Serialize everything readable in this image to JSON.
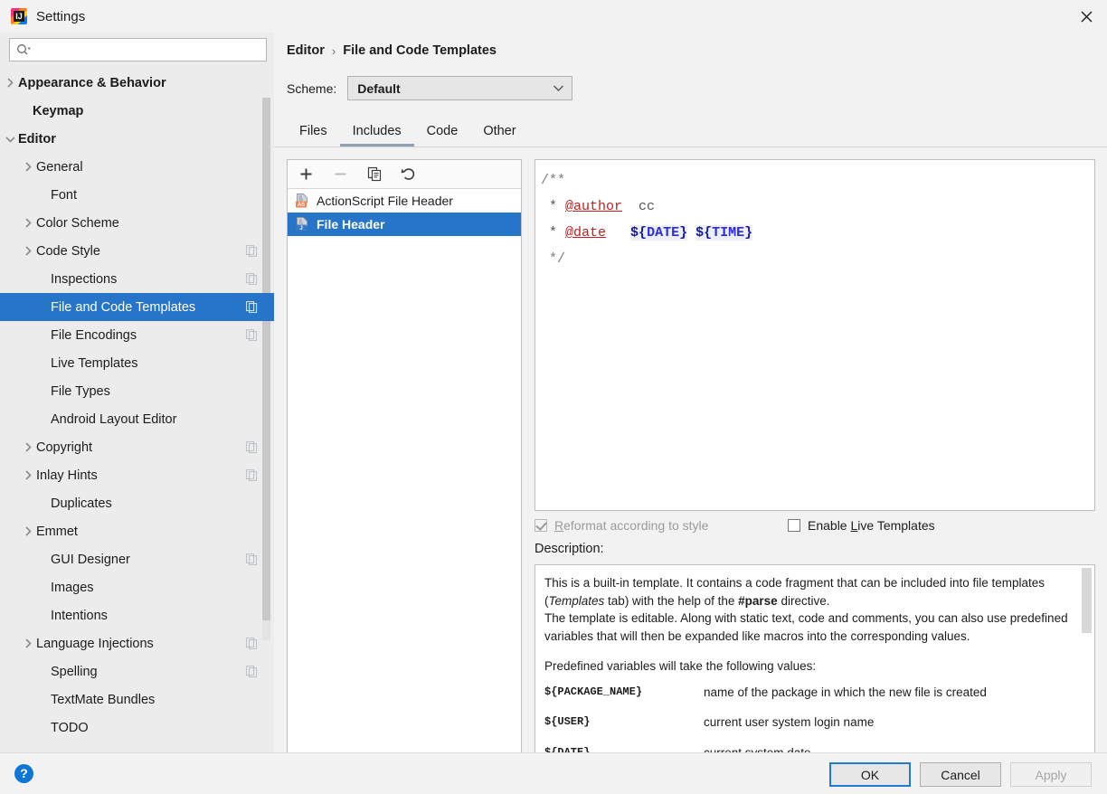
{
  "window": {
    "title": "Settings",
    "app_icon": "intellij-idea-icon",
    "close_icon": "close-icon"
  },
  "search": {
    "value": "",
    "placeholder": "",
    "icon": "search-icon"
  },
  "sidebar": {
    "items": [
      {
        "label": "Appearance & Behavior",
        "indent": 20,
        "arrow": "collapsed",
        "bold": true,
        "badge": false,
        "selected": false
      },
      {
        "label": "Keymap",
        "indent": 36,
        "arrow": "none",
        "bold": true,
        "badge": false,
        "selected": false
      },
      {
        "label": "Editor",
        "indent": 20,
        "arrow": "expanded",
        "bold": true,
        "badge": false,
        "selected": false
      },
      {
        "label": "General",
        "indent": 40,
        "arrow": "collapsed",
        "bold": false,
        "badge": false,
        "selected": false
      },
      {
        "label": "Font",
        "indent": 56,
        "arrow": "none",
        "bold": false,
        "badge": false,
        "selected": false
      },
      {
        "label": "Color Scheme",
        "indent": 40,
        "arrow": "collapsed",
        "bold": false,
        "badge": false,
        "selected": false
      },
      {
        "label": "Code Style",
        "indent": 40,
        "arrow": "collapsed",
        "bold": false,
        "badge": true,
        "selected": false
      },
      {
        "label": "Inspections",
        "indent": 56,
        "arrow": "none",
        "bold": false,
        "badge": true,
        "selected": false
      },
      {
        "label": "File and Code Templates",
        "indent": 56,
        "arrow": "none",
        "bold": false,
        "badge": true,
        "selected": true
      },
      {
        "label": "File Encodings",
        "indent": 56,
        "arrow": "none",
        "bold": false,
        "badge": true,
        "selected": false
      },
      {
        "label": "Live Templates",
        "indent": 56,
        "arrow": "none",
        "bold": false,
        "badge": false,
        "selected": false
      },
      {
        "label": "File Types",
        "indent": 56,
        "arrow": "none",
        "bold": false,
        "badge": false,
        "selected": false
      },
      {
        "label": "Android Layout Editor",
        "indent": 56,
        "arrow": "none",
        "bold": false,
        "badge": false,
        "selected": false
      },
      {
        "label": "Copyright",
        "indent": 40,
        "arrow": "collapsed",
        "bold": false,
        "badge": true,
        "selected": false
      },
      {
        "label": "Inlay Hints",
        "indent": 40,
        "arrow": "collapsed",
        "bold": false,
        "badge": true,
        "selected": false
      },
      {
        "label": "Duplicates",
        "indent": 56,
        "arrow": "none",
        "bold": false,
        "badge": false,
        "selected": false
      },
      {
        "label": "Emmet",
        "indent": 40,
        "arrow": "collapsed",
        "bold": false,
        "badge": false,
        "selected": false
      },
      {
        "label": "GUI Designer",
        "indent": 56,
        "arrow": "none",
        "bold": false,
        "badge": true,
        "selected": false
      },
      {
        "label": "Images",
        "indent": 56,
        "arrow": "none",
        "bold": false,
        "badge": false,
        "selected": false
      },
      {
        "label": "Intentions",
        "indent": 56,
        "arrow": "none",
        "bold": false,
        "badge": false,
        "selected": false
      },
      {
        "label": "Language Injections",
        "indent": 40,
        "arrow": "collapsed",
        "bold": false,
        "badge": true,
        "selected": false
      },
      {
        "label": "Spelling",
        "indent": 56,
        "arrow": "none",
        "bold": false,
        "badge": true,
        "selected": false
      },
      {
        "label": "TextMate Bundles",
        "indent": 56,
        "arrow": "none",
        "bold": false,
        "badge": false,
        "selected": false
      },
      {
        "label": "TODO",
        "indent": 56,
        "arrow": "none",
        "bold": false,
        "badge": false,
        "selected": false
      }
    ]
  },
  "breadcrumb": {
    "parent": "Editor",
    "separator": "›",
    "current": "File and Code Templates"
  },
  "scheme": {
    "label": "Scheme:",
    "value": "Default",
    "chevron_icon": "chevron-down-icon"
  },
  "tabs": [
    {
      "label": "Files",
      "active": false
    },
    {
      "label": "Includes",
      "active": true
    },
    {
      "label": "Code",
      "active": false
    },
    {
      "label": "Other",
      "active": false
    }
  ],
  "list_toolbar": [
    {
      "name": "add-template-button",
      "icon": "plus-icon",
      "disabled": false
    },
    {
      "name": "remove-template-button",
      "icon": "minus-icon",
      "disabled": true
    },
    {
      "name": "copy-template-button",
      "icon": "copy-icon",
      "disabled": false
    },
    {
      "name": "reset-template-button",
      "icon": "undo-icon",
      "disabled": false
    }
  ],
  "template_list": [
    {
      "label": "ActionScript File Header",
      "icon": "actionscript-file-icon",
      "badge_color": "#f0864a",
      "badge_text": "AS",
      "selected": false
    },
    {
      "label": "File Header",
      "icon": "java-file-icon",
      "badge_color": "#3b78c4",
      "badge_text": "J",
      "selected": true
    }
  ],
  "editor": {
    "lines": [
      {
        "parts": [
          {
            "text": "/**",
            "type": "comment"
          }
        ]
      },
      {
        "parts": [
          {
            "text": " * ",
            "type": "plain"
          },
          {
            "text": "@author",
            "type": "tag"
          },
          {
            "text": "  cc",
            "type": "plain"
          }
        ]
      },
      {
        "parts": [
          {
            "text": " * ",
            "type": "plain"
          },
          {
            "text": "@date",
            "type": "tag"
          },
          {
            "text": "   ",
            "type": "plain"
          },
          {
            "text": "${DATE}",
            "type": "var"
          },
          {
            "text": " ",
            "type": "plain"
          },
          {
            "text": "${TIME}",
            "type": "var"
          }
        ]
      },
      {
        "parts": [
          {
            "text": " */",
            "type": "comment"
          }
        ]
      }
    ],
    "raw_text": "/**\n * @author  cc\n * @date   ${DATE} ${TIME}\n */"
  },
  "options": {
    "reformat": {
      "label_before": "",
      "mnemonic": "R",
      "label_after": "eformat according to style",
      "checked": true,
      "disabled": true
    },
    "live_templates": {
      "label_before": "Enable ",
      "mnemonic": "L",
      "label_after": "ive Templates",
      "checked": false,
      "disabled": false
    }
  },
  "description": {
    "label": "Description:",
    "paragraph1_a": "This is a built-in template. It contains a code fragment that can be included into file templates (",
    "paragraph1_italic": "Templates",
    "paragraph1_b": " tab) with the help of the ",
    "paragraph1_bold": "#parse",
    "paragraph1_c": " directive.",
    "paragraph2": "The template is editable. Along with static text, code and comments, you can also use predefined variables that will then be expanded like macros into the corresponding values.",
    "paragraph3": "Predefined variables will take the following values:",
    "variables": [
      {
        "name": "${PACKAGE_NAME}",
        "desc": "name of the package in which the new file is created"
      },
      {
        "name": "${USER}",
        "desc": "current user system login name"
      },
      {
        "name": "${DATE}",
        "desc": "current system date"
      }
    ]
  },
  "footer": {
    "help_icon": "help-icon",
    "help_label": "?",
    "ok_label": "OK",
    "cancel_label": "Cancel",
    "apply_label": "Apply",
    "apply_disabled": true
  },
  "colors": {
    "selection_blue": "#2675c8",
    "focus_blue": "#1f7ad4",
    "window_bg": "#f2f2f2",
    "sidebar_bg": "#ececec",
    "tag_red": "#c02020",
    "var_blue": "#2a2ae8",
    "tab_underline": "#92a2b5"
  }
}
